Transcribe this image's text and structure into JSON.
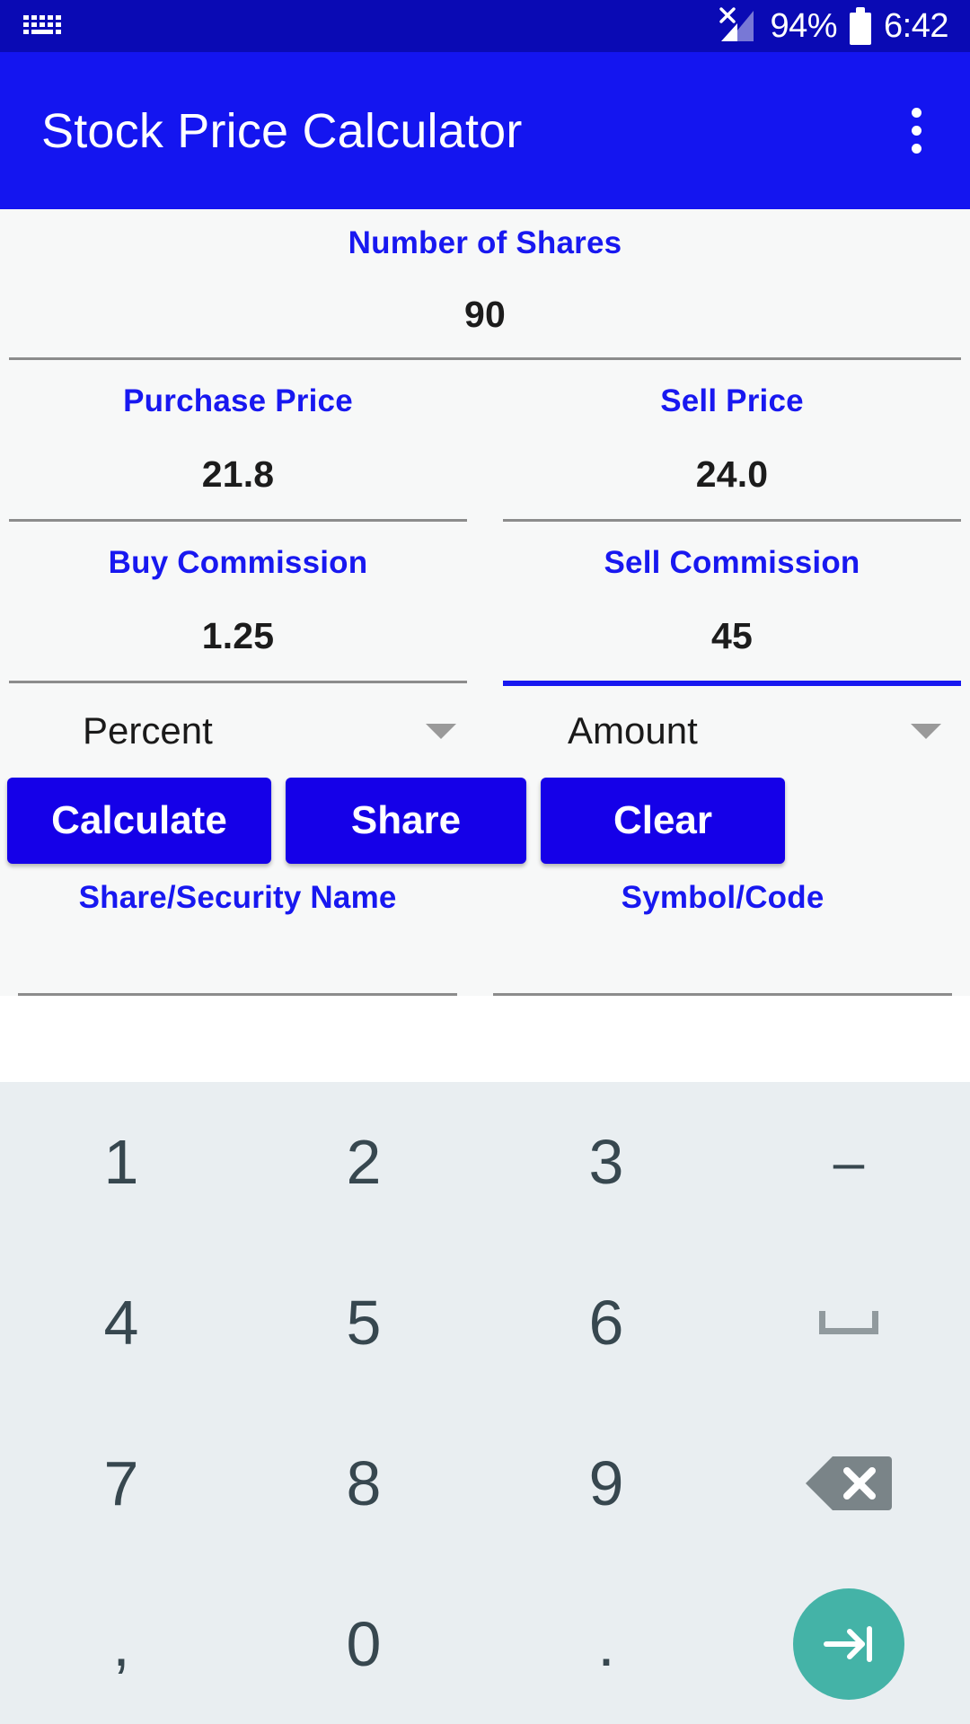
{
  "status_bar": {
    "keyboard_icon": "keyboard-icon",
    "signal_icon": "signal-no-sim-icon",
    "battery_percent": "94%",
    "battery_icon": "battery-icon",
    "time": "6:42"
  },
  "app_bar": {
    "title": "Stock Price Calculator",
    "overflow_icon": "overflow-menu-icon"
  },
  "form": {
    "shares": {
      "label": "Number of Shares",
      "value": "90",
      "focused": false
    },
    "purchase_price": {
      "label": "Purchase Price",
      "value": "21.8",
      "focused": false
    },
    "sell_price": {
      "label": "Sell Price",
      "value": "24.0",
      "focused": false
    },
    "buy_commission": {
      "label": "Buy Commission",
      "value": "1.25",
      "focused": false
    },
    "sell_commission": {
      "label": "Sell Commission",
      "value": "45",
      "focused": true
    },
    "buy_commission_type": {
      "selected": "Percent",
      "options": [
        "Percent",
        "Amount"
      ]
    },
    "sell_commission_type": {
      "selected": "Amount",
      "options": [
        "Percent",
        "Amount"
      ]
    },
    "security_name": {
      "label": "Share/Security Name",
      "value": "",
      "placeholder": ""
    },
    "symbol_code": {
      "label": "Symbol/Code",
      "value": "",
      "placeholder": ""
    }
  },
  "buttons": {
    "calculate": "Calculate",
    "share": "Share",
    "clear": "Clear"
  },
  "keyboard": {
    "rows": [
      [
        {
          "key": "1",
          "type": "digit"
        },
        {
          "key": "2",
          "type": "digit"
        },
        {
          "key": "3",
          "type": "digit"
        },
        {
          "key": "–",
          "type": "minus"
        }
      ],
      [
        {
          "key": "4",
          "type": "digit"
        },
        {
          "key": "5",
          "type": "digit"
        },
        {
          "key": "6",
          "type": "digit"
        },
        {
          "key": "space",
          "type": "space-icon"
        }
      ],
      [
        {
          "key": "7",
          "type": "digit"
        },
        {
          "key": "8",
          "type": "digit"
        },
        {
          "key": "9",
          "type": "digit"
        },
        {
          "key": "backspace",
          "type": "backspace-icon"
        }
      ],
      [
        {
          "key": ",",
          "type": "digit"
        },
        {
          "key": "0",
          "type": "digit"
        },
        {
          "key": ".",
          "type": "digit"
        },
        {
          "key": "enter",
          "type": "enter-icon"
        }
      ]
    ]
  },
  "colors": {
    "status_bar": "#0a0ab4",
    "app_bar": "#1415f0",
    "label_blue": "#1818f0",
    "button_blue": "#1500e8",
    "focus_underline": "#1818f0",
    "keyboard_bg": "#e9eef1",
    "key_text": "#37474f",
    "enter_teal": "#44b3a7"
  }
}
